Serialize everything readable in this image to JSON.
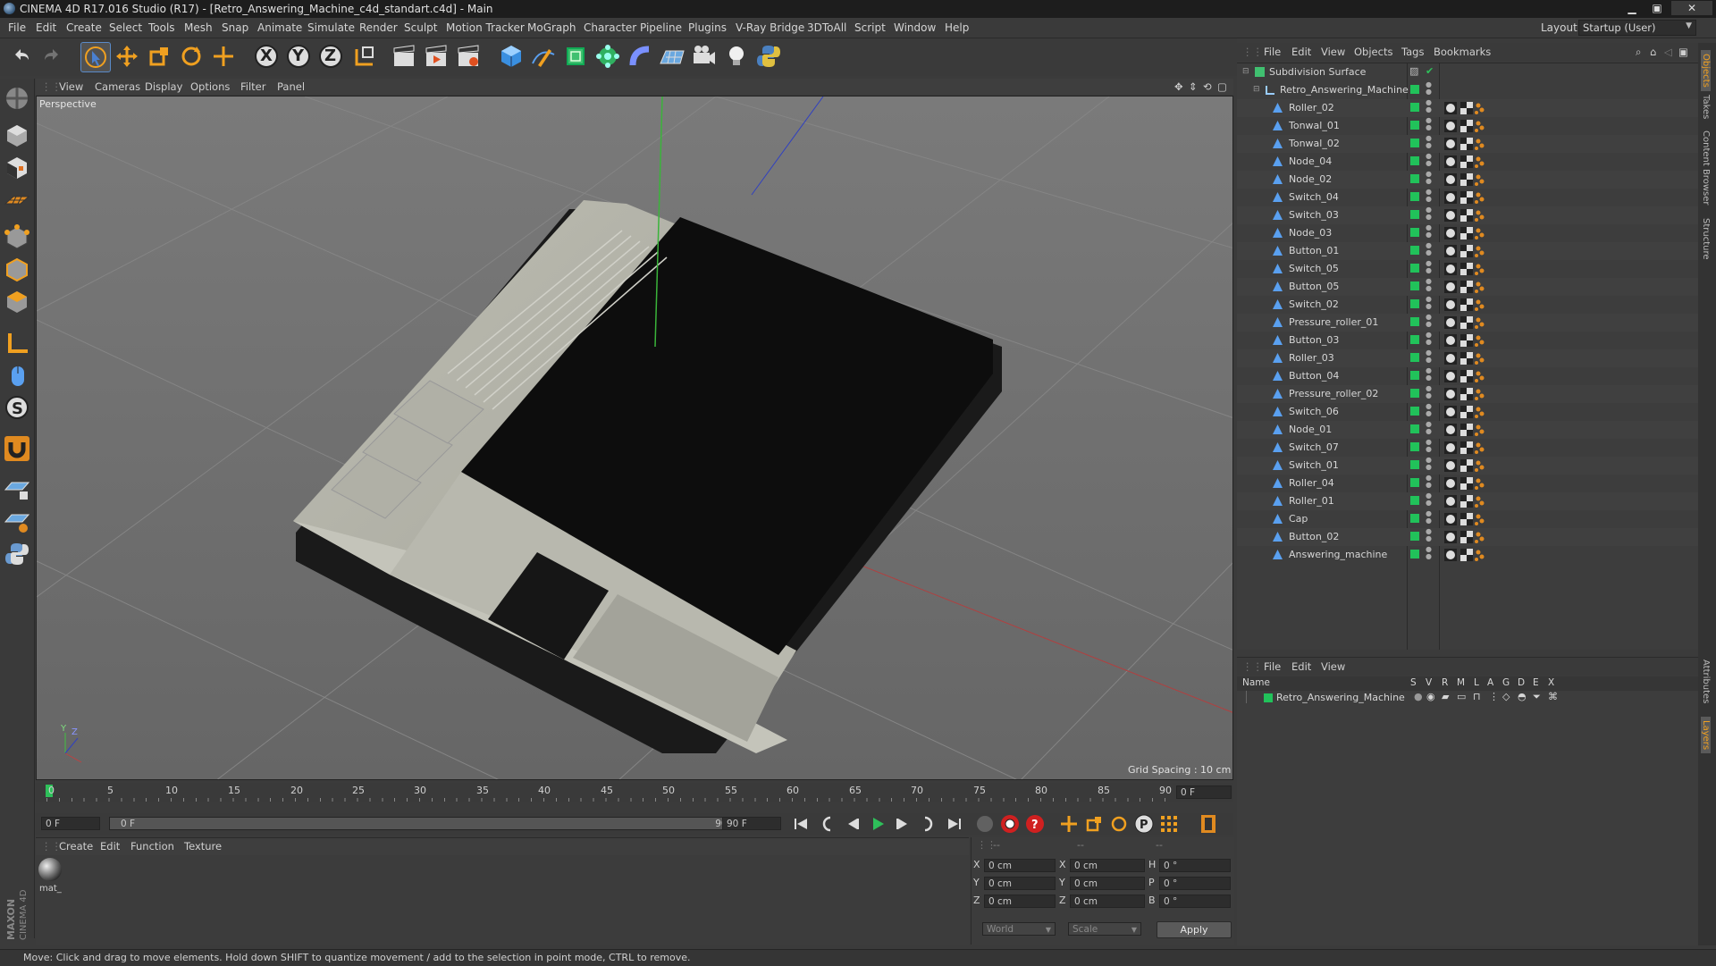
{
  "window": {
    "title": "CINEMA 4D R17.016 Studio (R17) - [Retro_Answering_Machine_c4d_standart.c4d] - Main",
    "layout_label": "Layout:",
    "layout_value": "Startup (User)"
  },
  "menubar": [
    "File",
    "Edit",
    "Create",
    "Select",
    "Tools",
    "Mesh",
    "Snap",
    "Animate",
    "Simulate",
    "Render",
    "Sculpt",
    "Motion Tracker",
    "MoGraph",
    "Character",
    "Pipeline",
    "Plugins",
    "V-Ray Bridge",
    "3DToAll",
    "Script",
    "Window",
    "Help"
  ],
  "toolbar": {
    "axis_x": "X",
    "axis_y": "Y",
    "axis_z": "Z"
  },
  "viewport": {
    "menu": [
      "View",
      "Cameras",
      "Display",
      "Options",
      "Filter",
      "Panel"
    ],
    "camera_label": "Perspective",
    "grid_spacing": "Grid Spacing : 10 cm",
    "axis_y": "Y",
    "axis_z": "Z"
  },
  "timeline": {
    "ticks": [
      "0",
      "5",
      "10",
      "15",
      "20",
      "25",
      "30",
      "35",
      "40",
      "45",
      "50",
      "55",
      "60",
      "65",
      "70",
      "75",
      "80",
      "85",
      "90"
    ],
    "current_frame_right": "0 F",
    "start_frame": "0 F",
    "range_start": "0 F",
    "range_end": "90 F",
    "end_frame": "90 F"
  },
  "material_manager": {
    "menu": [
      "Create",
      "Edit",
      "Function",
      "Texture"
    ],
    "materials": [
      {
        "name": "mat_"
      }
    ]
  },
  "coordinates": {
    "headers": [
      "--",
      "--",
      "--"
    ],
    "rows": [
      {
        "l1": "X",
        "v1": "0 cm",
        "l2": "X",
        "v2": "0 cm",
        "l3": "H",
        "v3": "0 °"
      },
      {
        "l1": "Y",
        "v1": "0 cm",
        "l2": "Y",
        "v2": "0 cm",
        "l3": "P",
        "v3": "0 °"
      },
      {
        "l1": "Z",
        "v1": "0 cm",
        "l2": "Z",
        "v2": "0 cm",
        "l3": "B",
        "v3": "0 °"
      }
    ],
    "mode1": "World",
    "mode2": "Scale",
    "apply": "Apply"
  },
  "status": "Move: Click and drag to move elements. Hold down SHIFT to quantize movement / add to the selection in point mode, CTRL to remove.",
  "object_manager": {
    "menu": [
      "File",
      "Edit",
      "View",
      "Objects",
      "Tags",
      "Bookmarks"
    ],
    "root": "Subdivision Surface",
    "group": "Retro_Answering_Machine",
    "children": [
      "Roller_02",
      "Tonwal_01",
      "Tonwal_02",
      "Node_04",
      "Node_02",
      "Switch_04",
      "Switch_03",
      "Node_03",
      "Button_01",
      "Switch_05",
      "Button_05",
      "Switch_02",
      "Pressure_roller_01",
      "Button_03",
      "Roller_03",
      "Button_04",
      "Pressure_roller_02",
      "Switch_06",
      "Node_01",
      "Switch_07",
      "Switch_01",
      "Roller_04",
      "Roller_01",
      "Cap",
      "Button_02",
      "Answering_machine"
    ]
  },
  "layer_manager": {
    "menu": [
      "File",
      "Edit",
      "View"
    ],
    "columns": [
      "Name",
      "S",
      "V",
      "R",
      "M",
      "L",
      "A",
      "G",
      "D",
      "E",
      "X"
    ],
    "layers": [
      "Retro_Answering_Machine"
    ]
  },
  "side_tabs": [
    "Objects",
    "Takes",
    "Content Browser",
    "Structure",
    "Attributes",
    "Layers"
  ],
  "maxon_logo": "MAXON CINEMA 4D",
  "colors": {
    "layer_green": "#21c25a",
    "accent_blue": "#4a90d9",
    "x_axis": "#c04040",
    "y_axis": "#40c040",
    "z_axis": "#3a4ad0"
  }
}
